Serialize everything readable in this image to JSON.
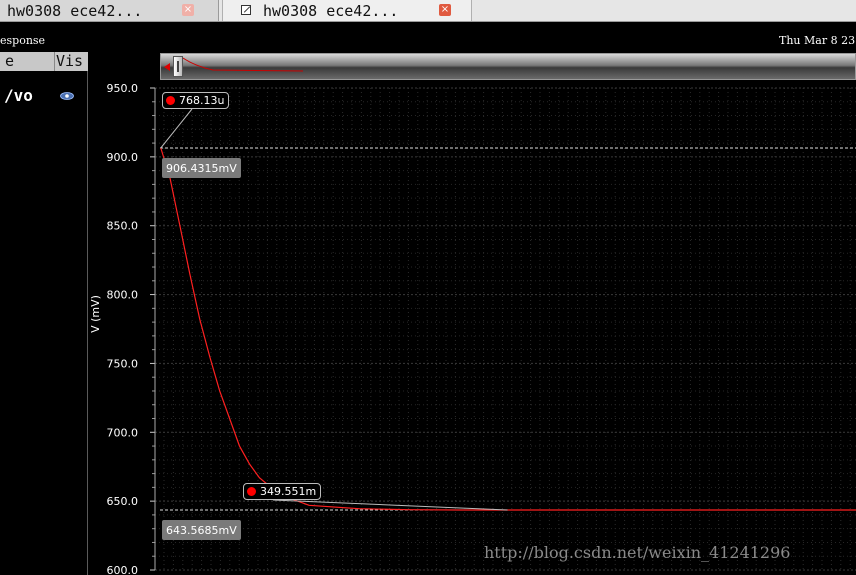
{
  "tabs": [
    {
      "label": "hw0308 ece42...",
      "close": "×",
      "icon": "close-icon"
    },
    {
      "label": "hw0308 ece42...",
      "close": "×",
      "icon": "close-icon",
      "file_icon": "file-icon"
    }
  ],
  "header": {
    "title": "esponse",
    "date": "Thu Mar 8 23"
  },
  "legend": {
    "col_name": "e",
    "col_vis": "Vis",
    "signal": "/vo",
    "visibility_icon": "eye-icon"
  },
  "chart_data": {
    "type": "line",
    "ylabel": "V (mV)",
    "ylim": [
      600.0,
      950.0
    ],
    "yticks": [
      "950.0",
      "900.0",
      "850.0",
      "800.0",
      "750.0",
      "700.0",
      "650.0",
      "600.0"
    ],
    "grid": true,
    "series": [
      {
        "color": "#ff2020",
        "x": [
          0.768,
          10,
          20,
          30,
          40,
          50,
          60,
          70,
          80,
          90,
          100,
          120,
          150,
          200,
          250,
          300,
          349.551,
          400,
          500,
          700
        ],
        "values": [
          906.4315,
          885,
          850,
          815,
          782,
          755,
          730,
          710,
          690,
          677,
          667,
          655,
          647,
          644.5,
          643.8,
          643.6,
          643.5685,
          643.57,
          643.57,
          643.57
        ]
      }
    ],
    "xlim": [
      0,
      700
    ],
    "markers": [
      {
        "label": "768.13u",
        "value_label": "906.4315mV",
        "x": 0.768,
        "y": 906.4315
      },
      {
        "label": "349.551m",
        "value_label": "643.5685mV",
        "x": 349.551,
        "y": 643.5685
      }
    ],
    "horizontal_lines": [
      906.4315,
      643.5685
    ]
  },
  "watermark": "http://blog.csdn.net/weixin_41241296",
  "colors": {
    "trace": "#ff2020",
    "grid": "#3a3a3a",
    "background": "#000000"
  }
}
